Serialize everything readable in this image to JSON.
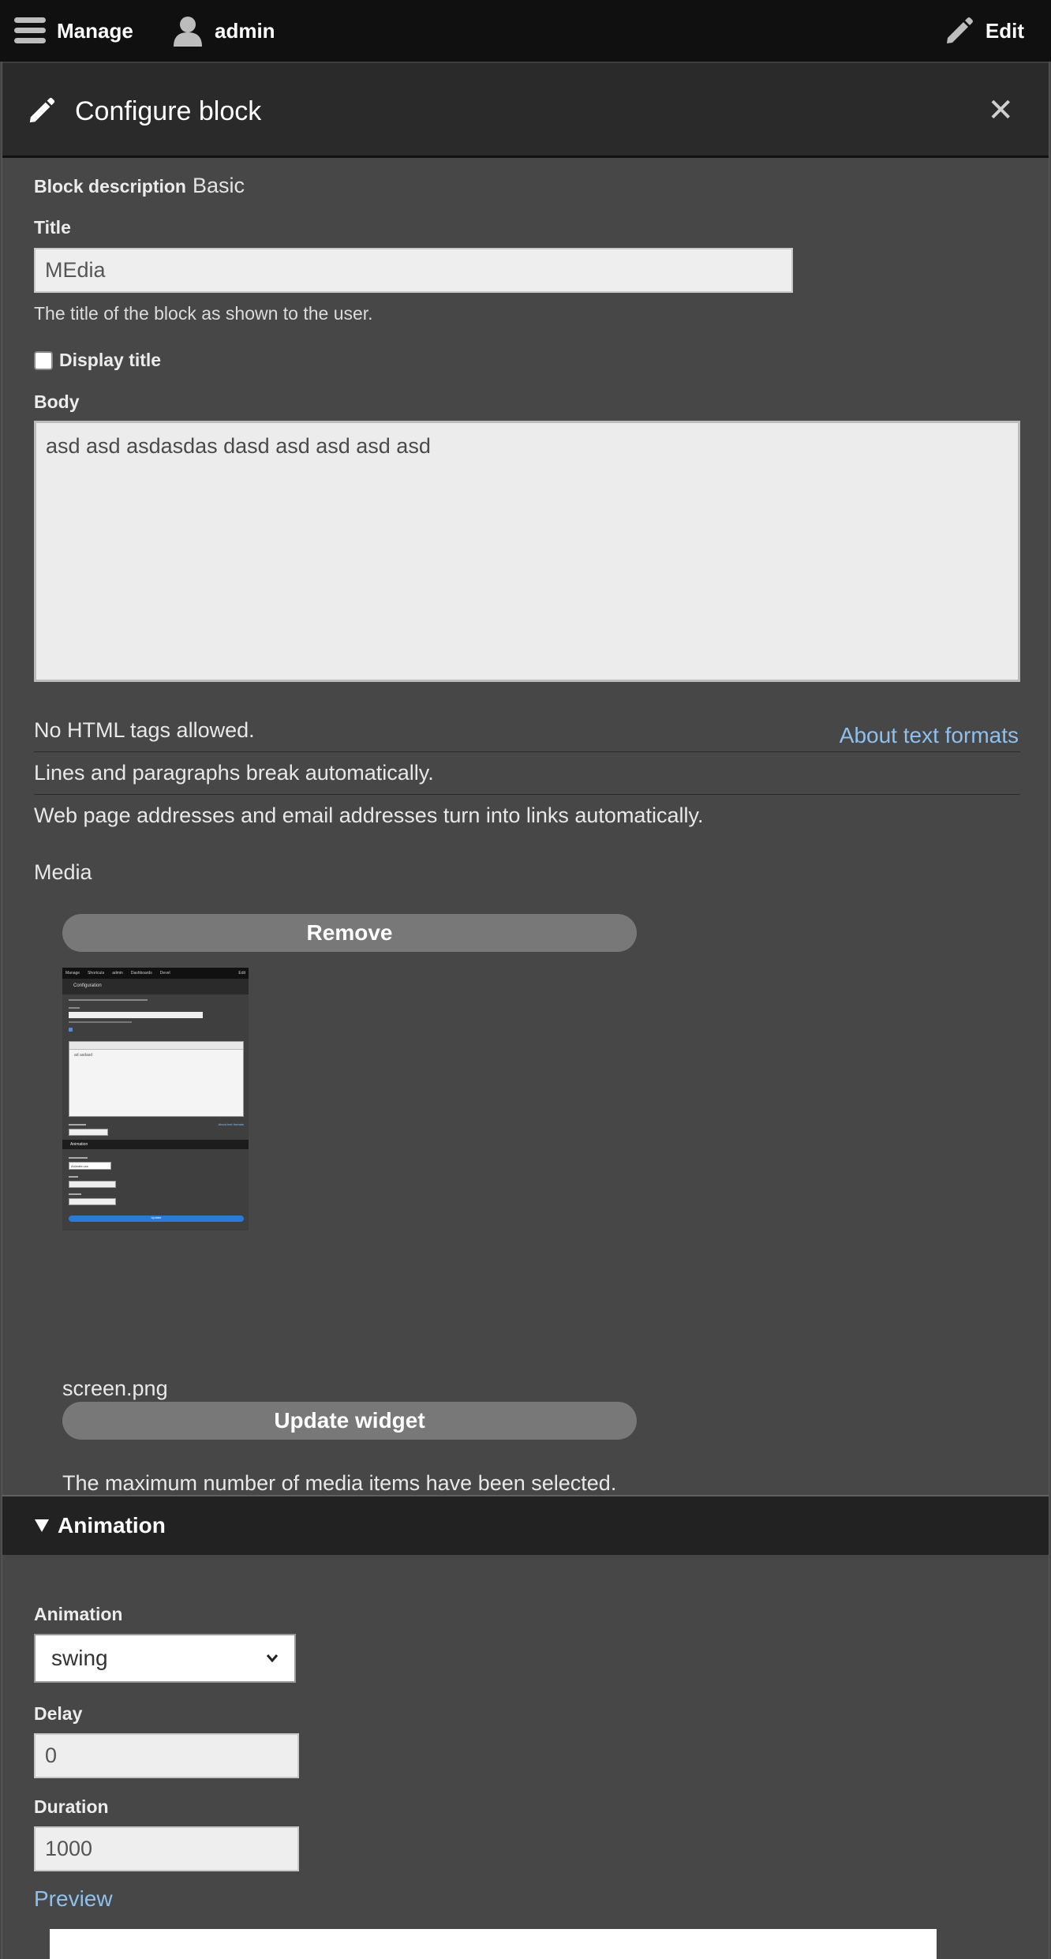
{
  "toolbar": {
    "manage_label": "Manage",
    "user_label": "admin",
    "edit_label": "Edit"
  },
  "dialog": {
    "title": "Configure block",
    "close_glyph": "✕"
  },
  "form": {
    "block_description_label": "Block description",
    "block_description_value": "Basic",
    "title_label": "Title",
    "title_value": "MEdia",
    "title_help": "The title of the block as shown to the user.",
    "display_title_label": "Display title",
    "display_title_checked": false,
    "body_label": "Body",
    "body_value": "asd asd asdasdas dasd asd asd asd asd",
    "format_tips": [
      "No HTML tags allowed.",
      "Lines and paragraphs break automatically.",
      "Web page addresses and email addresses turn into links automatically."
    ],
    "about_formats_link": "About text formats",
    "media_label": "Media",
    "remove_button": "Remove",
    "media_filename": "screen.png",
    "update_widget_button": "Update widget",
    "media_limit_message": "The maximum number of media items have been selected."
  },
  "thumbnail": {
    "toolbar_items": [
      "Manage",
      "Shortcuts",
      "admin",
      "Dashboards",
      "Devel",
      "Edit"
    ],
    "dialog_title": "Configuration",
    "body_text": "ad asdasd",
    "link_text": "About text formats",
    "section_title": "Animation",
    "select_value": "Animate.css",
    "button_text": "Update"
  },
  "animation": {
    "summary_label": "Animation",
    "animation_label": "Animation",
    "animation_value": "swing",
    "delay_label": "Delay",
    "delay_value": "0",
    "duration_label": "Duration",
    "duration_value": "1000",
    "preview_link": "Preview"
  },
  "icons": {
    "manage": "hamburger-icon",
    "user": "user-icon",
    "edit": "pencil-icon",
    "close": "close-icon",
    "caret": "triangle-down-icon"
  },
  "colors": {
    "toolbar_bg": "#101010",
    "dialog_bg": "#474747",
    "header_bg": "#2a2a2a",
    "link": "#8ec0ee",
    "pill_button": "#787878"
  }
}
